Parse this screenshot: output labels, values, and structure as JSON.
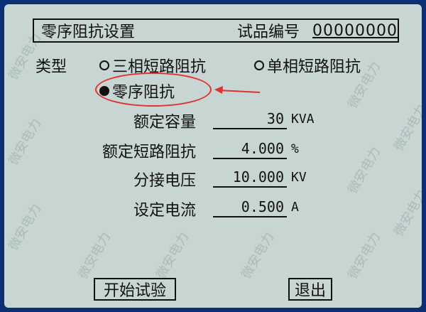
{
  "header": {
    "title": "零序阻抗设置",
    "sample_label": "试品编号",
    "sample_id": "00000000"
  },
  "type_row": {
    "label": "类型",
    "options": [
      {
        "label": "三相短路阻抗",
        "selected": false
      },
      {
        "label": "单相短路阻抗",
        "selected": false
      },
      {
        "label": "零序阻抗",
        "selected": true
      }
    ]
  },
  "fields": [
    {
      "label": "额定容量",
      "value": "30",
      "unit": "KVA"
    },
    {
      "label": "额定短路阻抗",
      "value": "4.000",
      "unit": "%"
    },
    {
      "label": "分接电压",
      "value": "10.000",
      "unit": "KV"
    },
    {
      "label": "设定电流",
      "value": "0.500",
      "unit": "A"
    }
  ],
  "buttons": {
    "start": "开始试验",
    "exit": "退出"
  },
  "watermark": "微安电力",
  "colors": {
    "screen_bg": "#c7d6d2",
    "frame": "#0b2f73",
    "annotation": "#e03030"
  }
}
